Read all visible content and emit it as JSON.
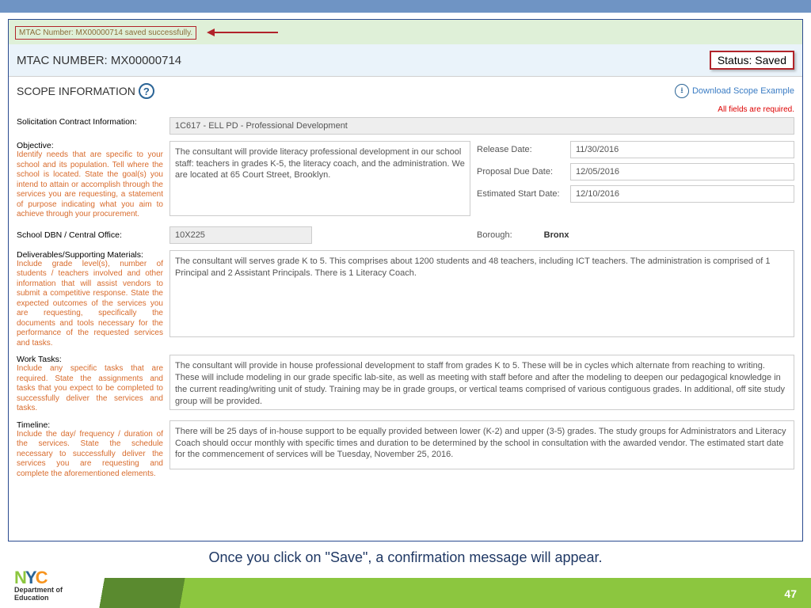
{
  "success_message": "MTAC Number: MX00000714 saved successfully.",
  "mtac_number_label": "MTAC NUMBER: MX00000714",
  "status_label": "Status: Saved",
  "scope_title": "SCOPE INFORMATION",
  "download_link": "Download Scope Example",
  "required_text": "All fields are required.",
  "solicitation_label": "Solicitation Contract Information:",
  "solicitation_value": "1C617 - ELL PD - Professional Development",
  "objective": {
    "label": "Objective:",
    "hint": "Identify needs that are specific to your school and its population. Tell where the school is located. State the goal(s) you intend to attain or accomplish through the services you are requesting, a statement of purpose indicating what you aim to achieve through your procurement.",
    "value": "The consultant will provide literacy professional development in our school staff: teachers in grades K-5, the literacy coach, and the administration. We are located at 65 Court Street, Brooklyn."
  },
  "dates": {
    "release_label": "Release Date:",
    "release_value": "11/30/2016",
    "proposal_label": "Proposal Due Date:",
    "proposal_value": "12/05/2016",
    "start_label": "Estimated Start Date:",
    "start_value": "12/10/2016"
  },
  "dbn": {
    "label": "School DBN / Central Office:",
    "value": "10X225",
    "borough_label": "Borough:",
    "borough_value": "Bronx"
  },
  "deliverables": {
    "label": "Deliverables/Supporting Materials:",
    "hint": "Include grade level(s), number of students / teachers involved and other information that will assist vendors to submit a competitive response. State the expected outcomes of the services you are requesting, specifically the documents and tools necessary for the performance of the requested services and tasks.",
    "value": "The consultant will serves grade K to 5. This comprises about 1200 students and 48 teachers, including ICT teachers. The administration is comprised of 1 Principal and 2 Assistant Principals. There is 1 Literacy Coach."
  },
  "work_tasks": {
    "label": "Work Tasks:",
    "hint": "Include any specific tasks that are required. State the assignments and tasks that you expect to be completed to successfully deliver the services and tasks.",
    "value": "The consultant will provide in house professional development to staff from grades K to 5. These will be in cycles which alternate from reaching to writing. These will include modeling in our grade specific lab-site, as well as meeting with staff before and after the modeling to deepen our pedagogical knowledge in the current reading/writing unit of study. Training may be in grade groups, or vertical teams comprised of various contiguous grades. In additional, off site study group will be provided."
  },
  "timeline": {
    "label": "Timeline:",
    "hint": "Include the day/ frequency / duration of the services. State the schedule necessary to successfully deliver the services you are requesting and complete the aforementioned elements.",
    "value": "There will be 25 days of in-house support to be equally provided between lower (K-2) and upper (3-5) grades. The study groups for Administrators and Literacy Coach should occur monthly with specific times and duration to be determined by the school in consultation with the awarded vendor. The estimated start date for the commencement of services will be Tuesday, November 25, 2016."
  },
  "caption": "Once you click on \"Save\", a confirmation message will appear.",
  "logo": {
    "dept": "Department of",
    "edu": "Education"
  },
  "page_number": "47"
}
